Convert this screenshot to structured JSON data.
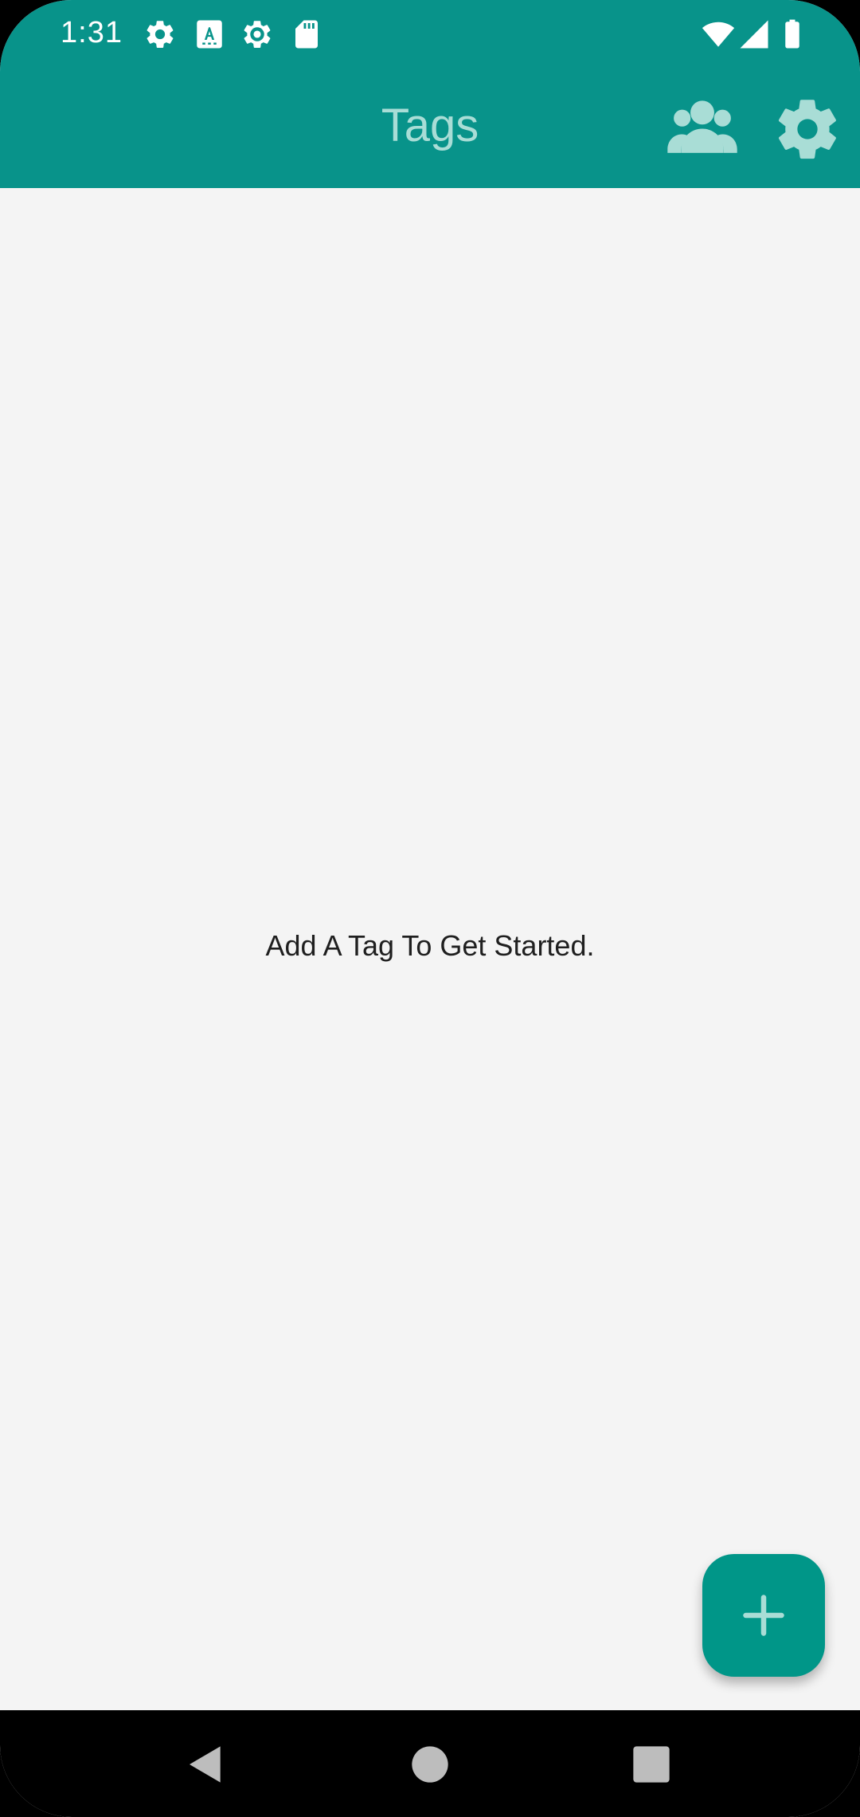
{
  "status_bar": {
    "time": "1:31",
    "left_icons": [
      "gear-icon",
      "keyboard-a-icon",
      "settings-outline-icon",
      "sd-card-icon"
    ],
    "right_icons": [
      "wifi-icon",
      "signal-icon",
      "battery-icon"
    ]
  },
  "app_bar": {
    "title": "Tags",
    "actions": [
      "group-icon",
      "settings-icon"
    ]
  },
  "main": {
    "empty_message": "Add A Tag To Get Started."
  },
  "fab": {
    "icon": "plus-icon"
  },
  "nav_bar": {
    "buttons": [
      "back-icon",
      "home-icon",
      "recents-icon"
    ]
  },
  "colors": {
    "primary": "#08938a",
    "fab": "#009688",
    "title": "#a9ddd6",
    "background": "#f4f4f4"
  }
}
